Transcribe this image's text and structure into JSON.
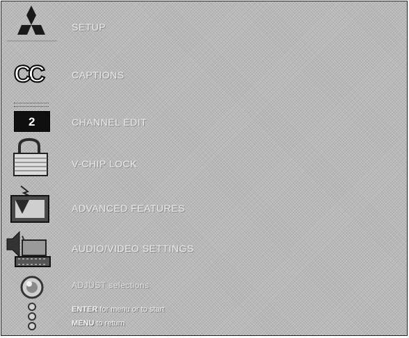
{
  "menu": {
    "items": [
      {
        "label": "SETUP"
      },
      {
        "label": "CAPTIONS"
      },
      {
        "label": "CHANNEL EDIT"
      },
      {
        "label": "V-CHIP LOCK"
      },
      {
        "label": "ADVANCED FEATURES"
      },
      {
        "label": "AUDIO/VIDEO SETTINGS"
      }
    ],
    "adjust_label": "ADJUST selections"
  },
  "icons": {
    "logo": "mitsubishi-logo-icon",
    "captions": "cc-icon",
    "channel": "channel-2-icon",
    "lock": "padlock-icon",
    "advanced": "advanced-features-icon",
    "audio_video": "audio-video-icon",
    "adjust": "adjust-knob-icon"
  },
  "channel_number": "2",
  "captions_glyph": "CC",
  "hints": {
    "enter_key": "ENTER",
    "enter_text": " for menu or to start",
    "menu_key": "MENU",
    "menu_text": " to return"
  },
  "colors": {
    "background": "#b9b9b9",
    "text": "#ececec"
  }
}
